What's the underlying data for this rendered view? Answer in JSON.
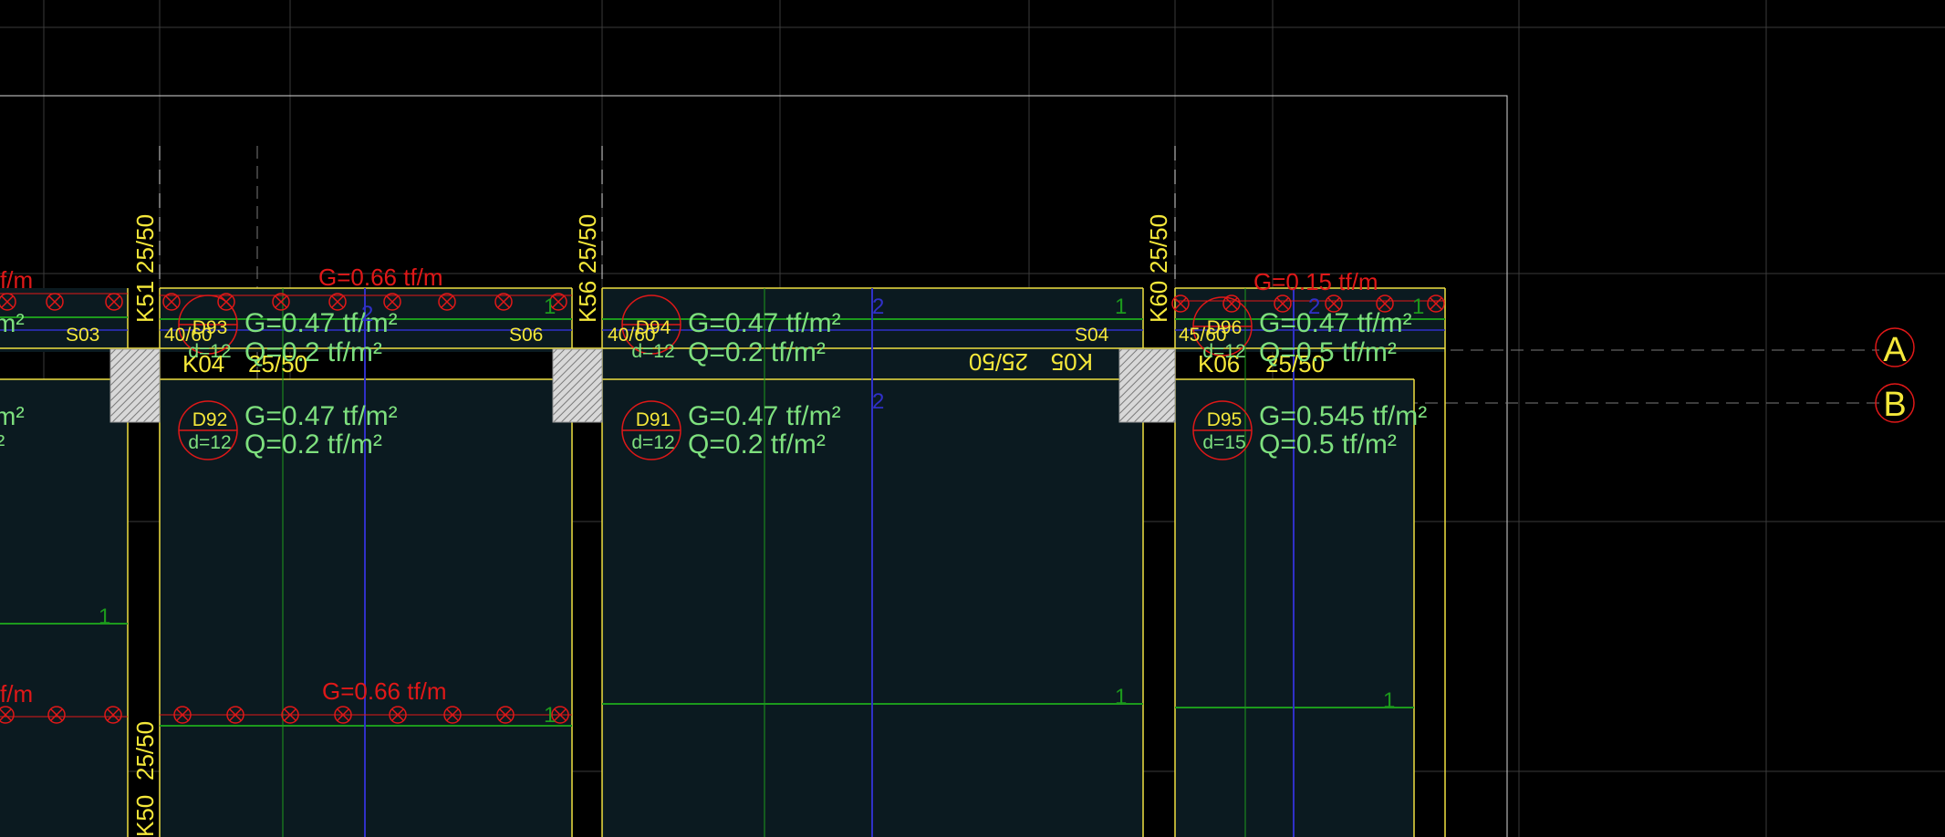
{
  "colors": {
    "background": "#000000",
    "slab_fill": "#0b1a20",
    "beam_outline": "#f0e040",
    "label_yellow": "#f5e83a",
    "load_green": "#7ee07e",
    "load_red": "#e01818",
    "grid_line": "#4a4a4a",
    "strip_green": "#1c9a1c",
    "strip_blue": "#3030c8",
    "column_hatch": "#bdbdbd",
    "axis_bubble": "#e01818"
  },
  "axes": {
    "a": "A",
    "b": "B"
  },
  "columns": {
    "k51": "K51",
    "k56": "K56",
    "k60": "K60",
    "k50": "K50",
    "dim_k51": "25/50",
    "dim_k56": "25/50",
    "dim_k60": "25/50",
    "dim_k50": "25/50"
  },
  "beams": {
    "k04": "K04",
    "k04_dim": "25/50",
    "k05": "K05",
    "k05_dim": "25/50",
    "k06": "K06",
    "k06_dim": "25/50"
  },
  "stairs_sections": {
    "s03": "S03",
    "s06": "S06",
    "s04": "S04"
  },
  "slabs": [
    {
      "id": "D93",
      "thickness": "d=12",
      "g": "G=0.47 tf/m²",
      "q": "Q=0.2 tf/m²",
      "size": "40/60"
    },
    {
      "id": "D94",
      "thickness": "d=12",
      "g": "G=0.47 tf/m²",
      "q": "Q=0.2 tf/m²",
      "size": "40/60"
    },
    {
      "id": "D96",
      "thickness": "d=12",
      "g": "G=0.47 tf/m²",
      "q": "Q=0.5 tf/m²",
      "size": "45/60"
    },
    {
      "id": "D92",
      "thickness": "d=12",
      "g": "G=0.47 tf/m²",
      "q": "Q=0.2 tf/m²"
    },
    {
      "id": "D91",
      "thickness": "d=12",
      "g": "G=0.47 tf/m²",
      "q": "Q=0.2 tf/m²"
    },
    {
      "id": "D95",
      "thickness": "d=15",
      "g": "G=0.545 tf/m²",
      "q": "Q=0.5 tf/m²"
    }
  ],
  "partial_left": {
    "load_top": "f/m",
    "load_bottom": "f/m",
    "m2_a": "m²",
    "m2_b": "m²",
    "m2_c": "²"
  },
  "line_loads": {
    "top_left": "G=0.66 tf/m",
    "top_right": "G=0.15 tf/m",
    "bottom": "G=0.66 tf/m"
  },
  "strip_numbers": {
    "one": "1",
    "two": "2"
  }
}
